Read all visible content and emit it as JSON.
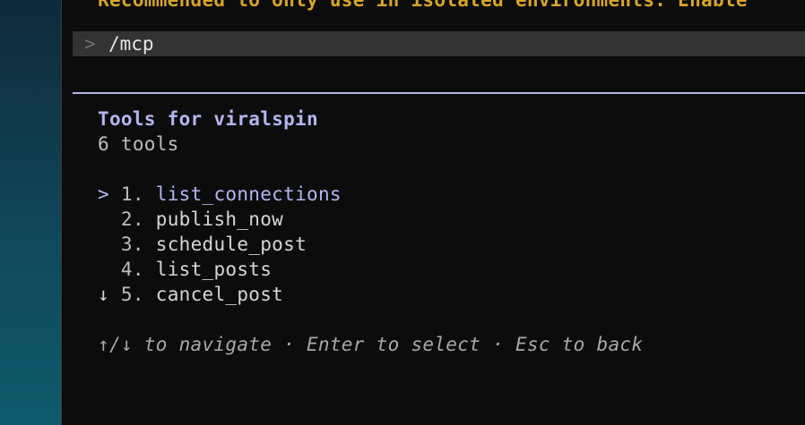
{
  "terminal": {
    "warning_line": "Recommended to only use in isolated environments. Enable",
    "prompt": {
      "caret": ">",
      "command": "/mcp"
    },
    "panel": {
      "title": "Tools for viralspin",
      "count": "6 tools",
      "items": [
        {
          "marker": ">",
          "number": "1.",
          "name": "list_connections",
          "selected": true
        },
        {
          "marker": " ",
          "number": "2.",
          "name": "publish_now",
          "selected": false
        },
        {
          "marker": " ",
          "number": "3.",
          "name": "schedule_post",
          "selected": false
        },
        {
          "marker": " ",
          "number": "4.",
          "name": "list_posts",
          "selected": false
        },
        {
          "marker": "↓",
          "number": "5.",
          "name": "cancel_post",
          "selected": false
        }
      ],
      "hint": "↑/↓ to navigate · Enter to select · Esc to back"
    }
  },
  "colors": {
    "accent": "#b3b6f0",
    "warning": "#d7a52b",
    "background": "#0c0c0c",
    "prompt_bar": "#333333"
  }
}
